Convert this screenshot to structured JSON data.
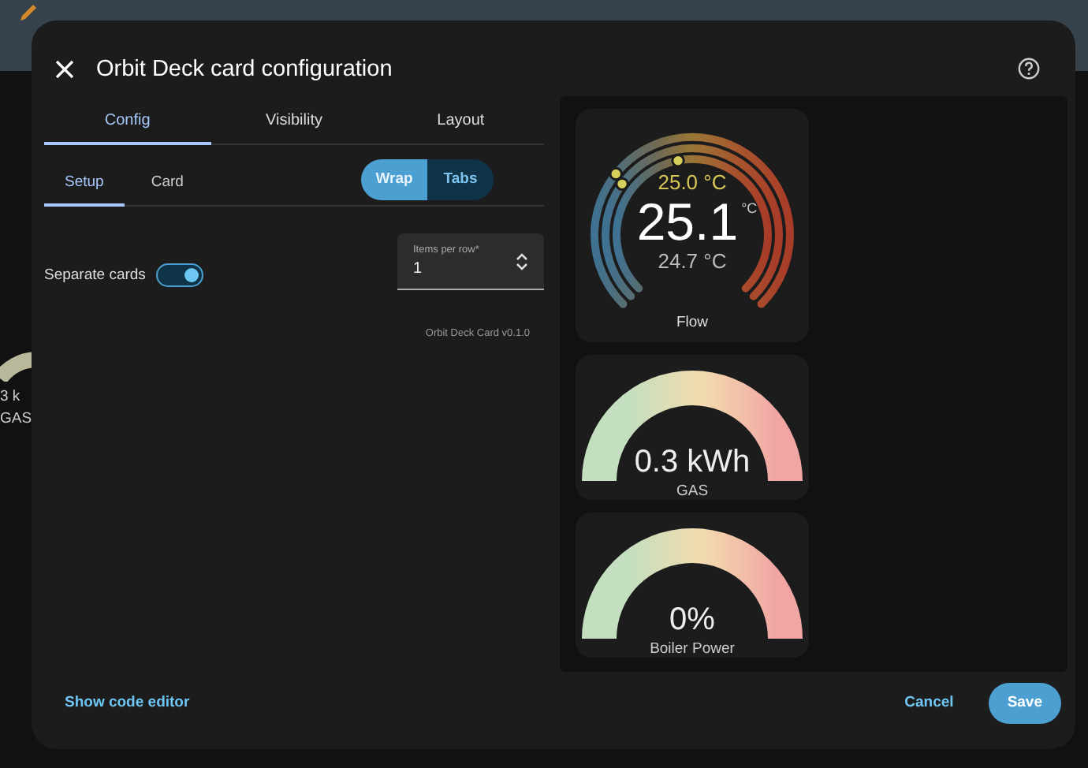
{
  "background": {
    "texts": [
      "3 k",
      "GAS"
    ]
  },
  "dialog": {
    "title": "Orbit Deck card configuration",
    "tabs": [
      {
        "label": "Config",
        "selected": true
      },
      {
        "label": "Visibility",
        "selected": false
      },
      {
        "label": "Layout",
        "selected": false
      }
    ],
    "subtabs": [
      {
        "label": "Setup",
        "selected": true
      },
      {
        "label": "Card",
        "selected": false
      }
    ],
    "layout_mode": [
      {
        "label": "Wrap",
        "selected": true
      },
      {
        "label": "Tabs",
        "selected": false
      }
    ],
    "separate_cards": {
      "label": "Separate cards",
      "on": true
    },
    "items_per_row": {
      "label": "Items per row*",
      "value": "1"
    },
    "version": "Orbit Deck Card v0.1.0",
    "preview": [
      {
        "kind": "thermostat",
        "value": "25.1",
        "unit": "°C",
        "target": "25.0 °C",
        "current": "24.7 °C",
        "name": "Flow"
      },
      {
        "kind": "gauge",
        "value": "0.3 kWh",
        "name": "GAS"
      },
      {
        "kind": "gauge",
        "value": "0%",
        "name": "Boiler Power"
      }
    ],
    "footer": {
      "code_editor": "Show code editor",
      "buttons": [
        "Cancel",
        "Save"
      ]
    }
  }
}
